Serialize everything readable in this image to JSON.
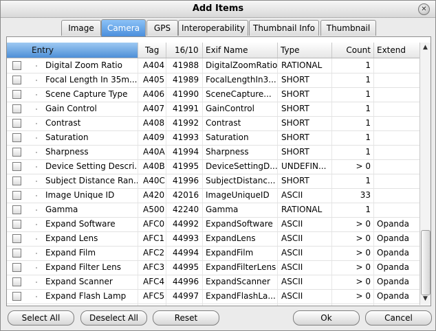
{
  "window": {
    "title": "Add Items",
    "close_glyph": "✕"
  },
  "tabs": [
    {
      "label": "Image",
      "active": false
    },
    {
      "label": "Camera",
      "active": true
    },
    {
      "label": "GPS",
      "active": false
    },
    {
      "label": "Interoperability",
      "active": false
    },
    {
      "label": "Thumbnail Info",
      "active": false
    },
    {
      "label": "Thumbnail",
      "active": false
    }
  ],
  "columns": {
    "entry": "Entry",
    "tag": "Tag",
    "num": "16/10",
    "exif": "Exif Name",
    "type": "Type",
    "count": "Count",
    "extend": "Extend"
  },
  "rows": [
    {
      "entry": "Digital Zoom Ratio",
      "tag": "A404",
      "num": "41988",
      "exif": "DigitalZoomRatio",
      "type": "RATIONAL",
      "count": "1",
      "extend": ""
    },
    {
      "entry": "Focal Length In 35m...",
      "tag": "A405",
      "num": "41989",
      "exif": "FocalLengthIn3...",
      "type": "SHORT",
      "count": "1",
      "extend": ""
    },
    {
      "entry": "Scene Capture Type",
      "tag": "A406",
      "num": "41990",
      "exif": "SceneCapture...",
      "type": "SHORT",
      "count": "1",
      "extend": ""
    },
    {
      "entry": "Gain Control",
      "tag": "A407",
      "num": "41991",
      "exif": "GainControl",
      "type": "SHORT",
      "count": "1",
      "extend": ""
    },
    {
      "entry": "Contrast",
      "tag": "A408",
      "num": "41992",
      "exif": "Contrast",
      "type": "SHORT",
      "count": "1",
      "extend": ""
    },
    {
      "entry": "Saturation",
      "tag": "A409",
      "num": "41993",
      "exif": "Saturation",
      "type": "SHORT",
      "count": "1",
      "extend": ""
    },
    {
      "entry": "Sharpness",
      "tag": "A40A",
      "num": "41994",
      "exif": "Sharpness",
      "type": "SHORT",
      "count": "1",
      "extend": ""
    },
    {
      "entry": "Device Setting Descri...",
      "tag": "A40B",
      "num": "41995",
      "exif": "DeviceSettingD...",
      "type": "UNDEFIN...",
      "count": "> 0",
      "extend": ""
    },
    {
      "entry": "Subject Distance Ran...",
      "tag": "A40C",
      "num": "41996",
      "exif": "SubjectDistanc...",
      "type": "SHORT",
      "count": "1",
      "extend": ""
    },
    {
      "entry": "Image Unique ID",
      "tag": "A420",
      "num": "42016",
      "exif": "ImageUniqueID",
      "type": "ASCII",
      "count": "33",
      "extend": ""
    },
    {
      "entry": "Gamma",
      "tag": "A500",
      "num": "42240",
      "exif": "Gamma",
      "type": "RATIONAL",
      "count": "1",
      "extend": ""
    },
    {
      "entry": "Expand Software",
      "tag": "AFC0",
      "num": "44992",
      "exif": "ExpandSoftware",
      "type": "ASCII",
      "count": "> 0",
      "extend": "Opanda"
    },
    {
      "entry": "Expand Lens",
      "tag": "AFC1",
      "num": "44993",
      "exif": "ExpandLens",
      "type": "ASCII",
      "count": "> 0",
      "extend": "Opanda"
    },
    {
      "entry": "Expand Film",
      "tag": "AFC2",
      "num": "44994",
      "exif": "ExpandFilm",
      "type": "ASCII",
      "count": "> 0",
      "extend": "Opanda"
    },
    {
      "entry": "Expand Filter Lens",
      "tag": "AFC3",
      "num": "44995",
      "exif": "ExpandFilterLens",
      "type": "ASCII",
      "count": "> 0",
      "extend": "Opanda"
    },
    {
      "entry": "Expand Scanner",
      "tag": "AFC4",
      "num": "44996",
      "exif": "ExpandScanner",
      "type": "ASCII",
      "count": "> 0",
      "extend": "Opanda"
    },
    {
      "entry": "Expand Flash Lamp",
      "tag": "AFC5",
      "num": "44997",
      "exif": "ExpandFlashLa...",
      "type": "ASCII",
      "count": "> 0",
      "extend": "Opanda"
    }
  ],
  "scrollbar": {
    "up_glyph": "▲",
    "down_glyph": "▼"
  },
  "buttons": {
    "select_all": "Select All",
    "deselect_all": "Deselect All",
    "reset": "Reset",
    "ok": "Ok",
    "cancel": "Cancel"
  },
  "colors": {
    "accent": "#4b8fdc",
    "header_selected": "#9ec9f2"
  },
  "icons": {
    "close": "close-icon",
    "scroll_up": "scroll-up-icon",
    "scroll_down": "scroll-down-icon",
    "checkbox": "checkbox-icon"
  }
}
